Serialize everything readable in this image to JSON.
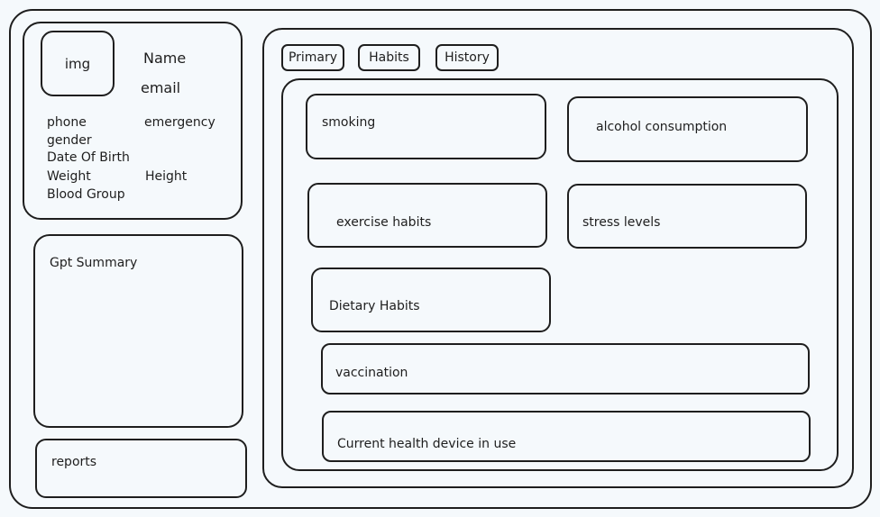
{
  "profile": {
    "image_label": "img",
    "name": "Name",
    "email": "email",
    "phone": "phone",
    "emergency": "emergency",
    "gender": "gender",
    "dob": "Date Of Birth",
    "weight": "Weight",
    "height": "Height",
    "blood_group": "Blood Group"
  },
  "gpt_summary": {
    "title": "Gpt Summary"
  },
  "reports": {
    "title": "reports"
  },
  "tabs": [
    {
      "label": "Primary"
    },
    {
      "label": "Habits"
    },
    {
      "label": "History"
    }
  ],
  "habits": {
    "smoking": "smoking",
    "alcohol": "alcohol consumption",
    "exercise": "exercise habits",
    "stress": "stress levels",
    "dietary": "Dietary Habits",
    "vaccination": "vaccination",
    "device": "Current health device in use"
  }
}
